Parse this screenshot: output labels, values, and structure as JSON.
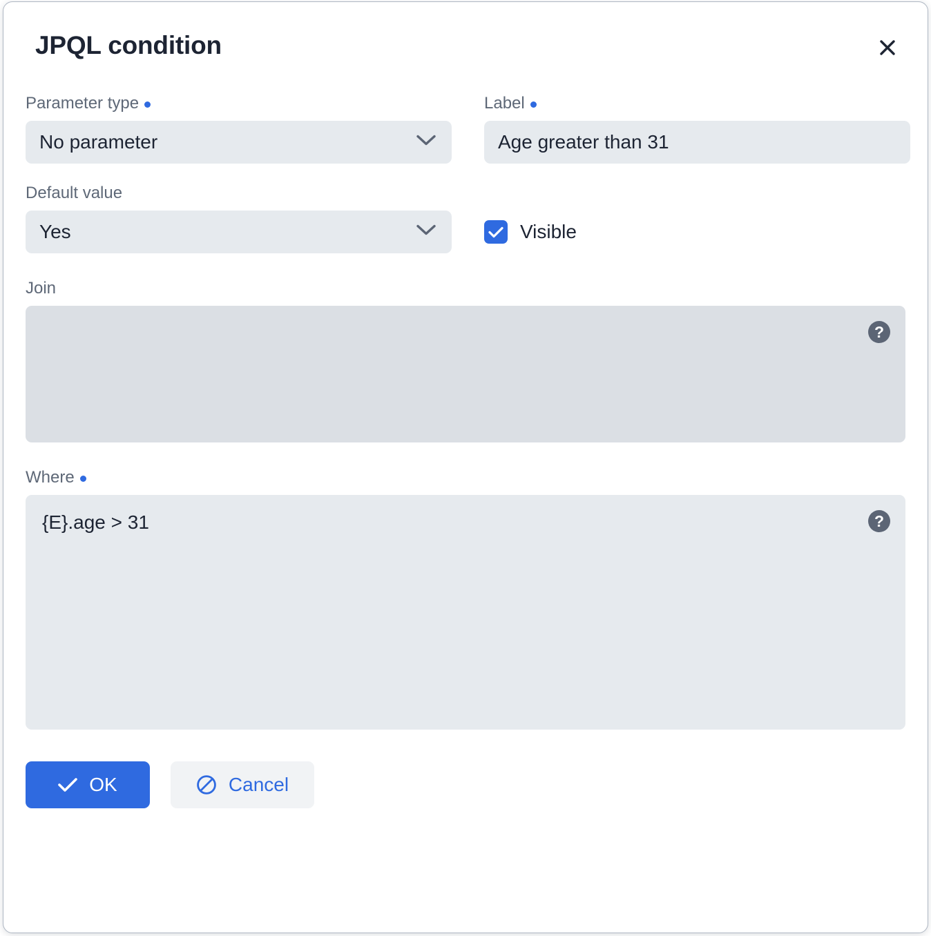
{
  "dialog": {
    "title": "JPQL condition",
    "close_label": "×"
  },
  "fields": {
    "parameter_type": {
      "label": "Parameter type",
      "required": true,
      "value": "No parameter",
      "chevron_icon": "chevron-down-icon"
    },
    "label": {
      "label": "Label",
      "required": true,
      "value": "Age greater than 31"
    },
    "default_value": {
      "label": "Default value",
      "required": false,
      "value": "Yes",
      "chevron_icon": "chevron-down-icon"
    },
    "visible": {
      "label": "Visible",
      "checked": true
    },
    "join": {
      "label": "Join",
      "required": false,
      "value": "",
      "help_icon": "?"
    },
    "where": {
      "label": "Where",
      "required": true,
      "value": "{E}.age > 31",
      "help_icon": "?"
    }
  },
  "footer": {
    "ok_label": "OK",
    "cancel_label": "Cancel",
    "ok_icon": "check-icon",
    "cancel_icon": "ban-icon"
  },
  "colors": {
    "accent": "#2f6ae0",
    "field_bg": "#e6eaee",
    "field_bg_dark": "#dbdfe4",
    "label_text": "#5e6877",
    "value_text": "#1d2433",
    "help_icon_bg": "#5c6575"
  }
}
